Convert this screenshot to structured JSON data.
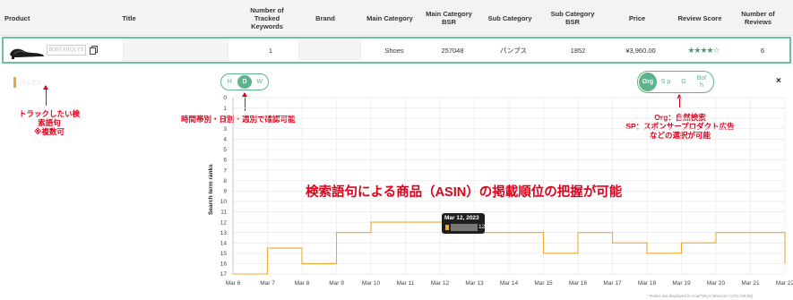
{
  "table": {
    "headers": [
      "Product",
      "Title",
      "Number of Tracked Keywords",
      "Brand",
      "Main Category",
      "Main Category BSR",
      "Sub Category",
      "Sub Category BSR",
      "Price",
      "Review Score",
      "Number of Reviews"
    ],
    "row": {
      "asin": "B0BTXRQLYS",
      "tracked_keywords": "1",
      "main_category": "Shoes",
      "main_bsr": "257048",
      "sub_category": "パンプス",
      "sub_bsr": "1852",
      "price": "¥3,960.00",
      "review_stars": "★★★★☆",
      "reviews": "6"
    }
  },
  "controls": {
    "granularity": [
      {
        "label": "H"
      },
      {
        "label": "D",
        "active": true
      },
      {
        "label": "W"
      }
    ],
    "type": [
      {
        "label": "Org",
        "active": true
      },
      {
        "label": "S p"
      },
      {
        "label": "G"
      },
      {
        "label": "Bot h"
      }
    ],
    "close": "×",
    "keyword_chip": "パンプス"
  },
  "annotations": {
    "keyword": "トラックしたい検索語句\n※複数可",
    "granularity": "時間帯別・日別・週別で確認可能",
    "type": "Org：自然検索\nSP：スポンサープロダクト広告\nなどの選択が可能",
    "main": "検索語句による商品（ASIN）の掲載順位の把握が可能"
  },
  "tooltip": {
    "date": "Mar 12, 2023",
    "value": "12"
  },
  "footnote": "* Ranks are displayed in Asia/Tokyo timezone (UTC+09:00)",
  "colors": {
    "accent": "#5db38c",
    "line": "#f0a830",
    "annotation": "#e0001a"
  },
  "chart_data": {
    "type": "line",
    "ylabel": "Search term ranks",
    "y_ticks": [
      "0",
      "1",
      "2",
      "3",
      "4",
      "5",
      "6",
      "7",
      "8",
      "9",
      "10",
      "11",
      "12",
      "13",
      "14",
      "15",
      "16",
      "17"
    ],
    "ylim": [
      0,
      17
    ],
    "y_reversed": true,
    "x_ticks": [
      "Mar 6",
      "Mar 7",
      "Mar 8",
      "Mar 9",
      "Mar 10",
      "Mar 11",
      "Mar 12",
      "Mar 13",
      "Mar 14",
      "Mar 15",
      "Mar 16",
      "Mar 17",
      "Mar 18",
      "Mar 19",
      "Mar 20",
      "Mar 21",
      "Mar 22"
    ],
    "series": [
      {
        "step": true,
        "x": [
          "Mar 6",
          "Mar 7",
          "Mar 8",
          "Mar 9",
          "Mar 10",
          "Mar 11",
          "Mar 12",
          "Mar 13",
          "Mar 14",
          "Mar 15",
          "Mar 16",
          "Mar 17",
          "Mar 18",
          "Mar 19",
          "Mar 20",
          "Mar 21",
          "Mar 22"
        ],
        "values": [
          17,
          14.5,
          16,
          13,
          12,
          12,
          12,
          13,
          13,
          15,
          13,
          14,
          15,
          14,
          13,
          13,
          16
        ]
      }
    ],
    "grid": true
  }
}
